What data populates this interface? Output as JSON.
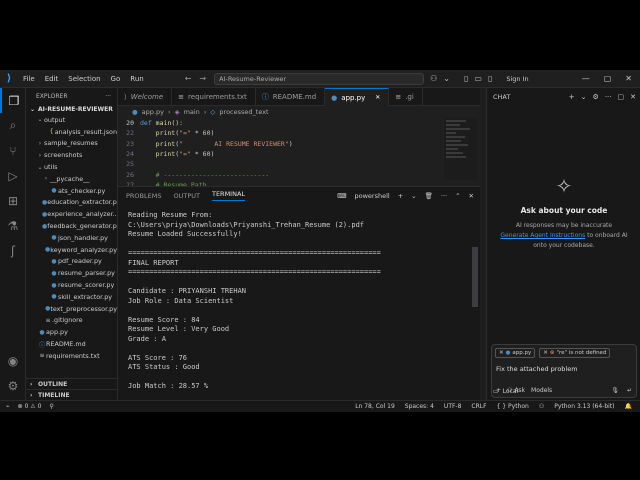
{
  "titlebar": {
    "menu": [
      "File",
      "Edit",
      "Selection",
      "Go",
      "Run"
    ],
    "more": "···",
    "search": "AI-Resume-Reviewer",
    "signin": "Sign In"
  },
  "sidebar": {
    "title": "EXPLORER",
    "project": "AI-RESUME-REVIEWER",
    "items": [
      {
        "label": "output",
        "kind": "folder-open",
        "depth": 1
      },
      {
        "label": "analysis_result.json",
        "kind": "json",
        "depth": 2
      },
      {
        "label": "sample_resumes",
        "kind": "folder",
        "depth": 1
      },
      {
        "label": "screenshots",
        "kind": "folder",
        "depth": 1
      },
      {
        "label": "utils",
        "kind": "folder-open",
        "depth": 1
      },
      {
        "label": "__pycache__",
        "kind": "folder",
        "depth": 2
      },
      {
        "label": "ats_checker.py",
        "kind": "py",
        "depth": 2
      },
      {
        "label": "education_extractor.py",
        "kind": "py",
        "depth": 2
      },
      {
        "label": "experience_analyzer....",
        "kind": "py",
        "depth": 2
      },
      {
        "label": "feedback_generator.py",
        "kind": "py",
        "depth": 2
      },
      {
        "label": "json_handler.py",
        "kind": "py",
        "depth": 2
      },
      {
        "label": "keyword_analyzer.py",
        "kind": "py",
        "depth": 2
      },
      {
        "label": "pdf_reader.py",
        "kind": "py",
        "depth": 2
      },
      {
        "label": "resume_parser.py",
        "kind": "py",
        "depth": 2
      },
      {
        "label": "resume_scorer.py",
        "kind": "py",
        "depth": 2
      },
      {
        "label": "skill_extractor.py",
        "kind": "py",
        "depth": 2
      },
      {
        "label": "text_preprocessor.py",
        "kind": "py",
        "depth": 2
      },
      {
        "label": ".gitignore",
        "kind": "txt",
        "depth": 1
      },
      {
        "label": "app.py",
        "kind": "py",
        "depth": 0
      },
      {
        "label": "README.md",
        "kind": "md",
        "depth": 0
      },
      {
        "label": "requirements.txt",
        "kind": "txt",
        "depth": 0
      }
    ],
    "outline": "OUTLINE",
    "timeline": "TIMELINE"
  },
  "editor": {
    "tabs": [
      {
        "label": "Welcome",
        "kind": "welcome",
        "italic": true
      },
      {
        "label": "requirements.txt",
        "kind": "txt"
      },
      {
        "label": "README.md",
        "kind": "md"
      },
      {
        "label": "app.py",
        "kind": "py",
        "active": true
      },
      {
        "label": ".gi",
        "kind": "txt"
      }
    ],
    "breadcrumb": [
      "app.py",
      "main",
      "processed_text"
    ],
    "lines": [
      {
        "n": "20",
        "code": "def main():"
      },
      {
        "n": "22",
        "code": "    print(\"=\" * 60)"
      },
      {
        "n": "23",
        "code": "    print(\"        AI RESUME REVIEWER\")"
      },
      {
        "n": "24",
        "code": "    print(\"=\" * 60)"
      },
      {
        "n": "25",
        "code": ""
      },
      {
        "n": "26",
        "code": "    # ---------------------------"
      },
      {
        "n": "27",
        "code": "    # Resume Path"
      }
    ]
  },
  "panel": {
    "tabs": [
      "PROBLEMS",
      "OUTPUT",
      "TERMINAL"
    ],
    "active_tab": "TERMINAL",
    "shell": "powershell",
    "lines": [
      "Reading Resume From:",
      "C:\\Users\\priya\\Downloads\\Priyanshi_Trehan_Resume (2).pdf",
      "Resume Loaded Successfully!",
      "",
      "============================================================",
      "FINAL REPORT",
      "============================================================",
      "",
      "Candidate : PRIYANSHI TREHAN",
      "Job Role : Data Scientist",
      "",
      "Resume Score : 84",
      "Resume Level : Very Good",
      "Grade : A",
      "",
      "ATS Score : 76",
      "ATS Status : Good",
      "",
      "Job Match : 28.57 %"
    ]
  },
  "chat": {
    "title": "CHAT",
    "heading": "Ask about your code",
    "desc_before": "AI responses may be inaccurate",
    "desc_link": "Generate Agent Instructions",
    "desc_after": "to onboard AI onto your codebase.",
    "chips": [
      "app.py",
      "\"re\" is not defined"
    ],
    "prompt": "Fix the attached problem",
    "mode": "Ask",
    "models": "Models",
    "local": "Local"
  },
  "status": {
    "errors": "0",
    "warnings": "0",
    "position": "Ln 78, Col 19",
    "spaces": "Spaces: 4",
    "encoding": "UTF-8",
    "eol": "CRLF",
    "lang": "Python",
    "interpreter": "Python 3.13 (64-bit)"
  }
}
